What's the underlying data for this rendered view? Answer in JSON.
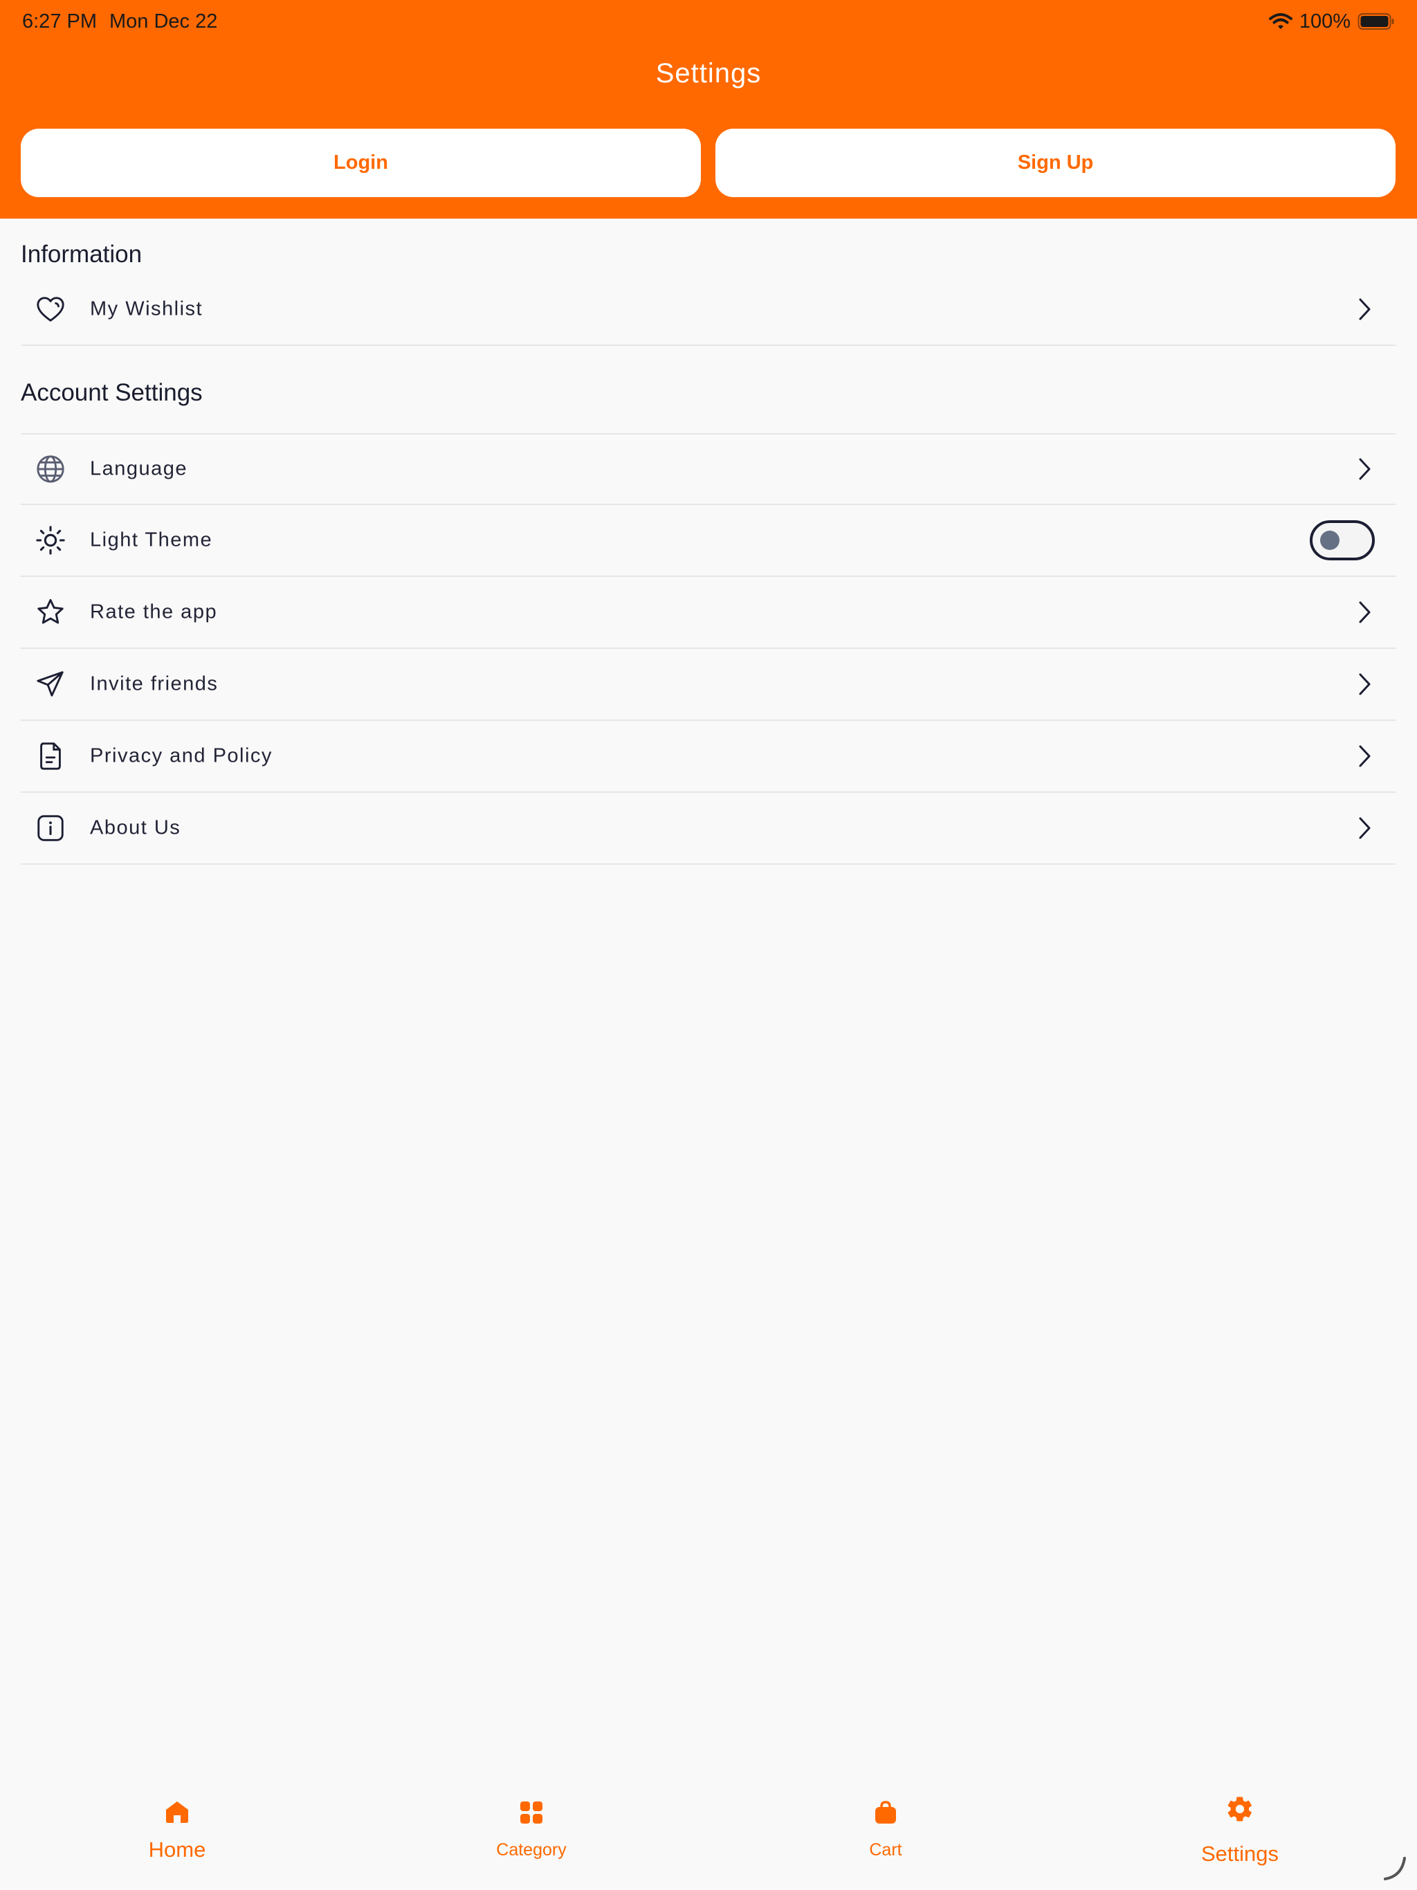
{
  "status_bar": {
    "time": "6:27 PM",
    "date": "Mon Dec 22",
    "battery": "100%",
    "icons": [
      "wifi-icon",
      "battery-icon"
    ]
  },
  "header": {
    "title": "Settings",
    "login_label": "Login",
    "signup_label": "Sign Up"
  },
  "information": {
    "heading": "Information",
    "items": [
      {
        "label": "My Wishlist",
        "icon": "heart-icon"
      }
    ]
  },
  "account_settings": {
    "heading": "Account Settings",
    "items": [
      {
        "label": "Language",
        "icon": "globe-icon"
      },
      {
        "label": "Light Theme",
        "icon": "sun-icon",
        "toggle_on": false
      },
      {
        "label": "Rate the app",
        "icon": "star-icon"
      },
      {
        "label": "Invite friends",
        "icon": "send-icon"
      },
      {
        "label": "Privacy and Policy",
        "icon": "document-icon"
      },
      {
        "label": "About Us",
        "icon": "info-icon"
      }
    ]
  },
  "tab_bar": {
    "tabs": [
      {
        "label": "Home",
        "icon": "home-icon"
      },
      {
        "label": "Category",
        "icon": "grid-icon"
      },
      {
        "label": "Cart",
        "icon": "bag-icon"
      },
      {
        "label": "Settings",
        "icon": "gear-icon",
        "active": true
      }
    ]
  },
  "colors": {
    "accent": "#ff6900",
    "background": "#f9f9f9",
    "text": "#1f2133",
    "divider": "#e6e6e6"
  }
}
